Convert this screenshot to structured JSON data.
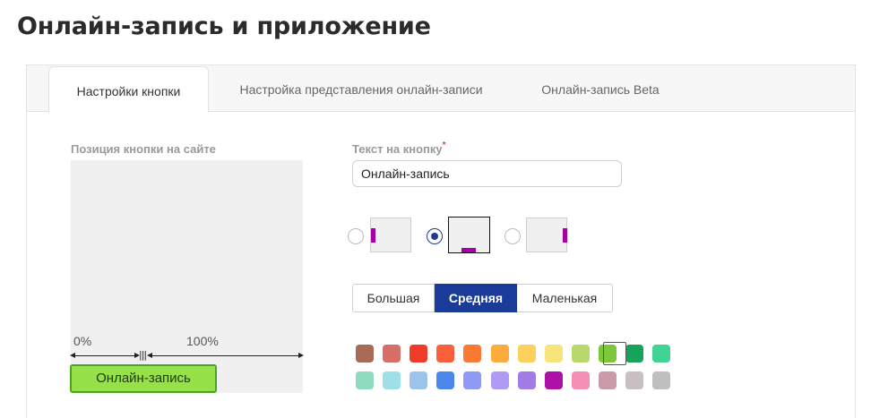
{
  "page": {
    "title": "Онлайн-запись и приложение"
  },
  "tabs": [
    {
      "label": "Настройки кнопки",
      "active": true
    },
    {
      "label": "Настройка представления онлайн-записи",
      "active": false
    },
    {
      "label": "Онлайн-запись Beta",
      "active": false
    }
  ],
  "position": {
    "label": "Позиция кнопки на сайте",
    "left_percent": "0%",
    "right_percent": "100%",
    "preview_button_label": "Онлайн-запись"
  },
  "button_text": {
    "label": "Текст на кнопку",
    "required_mark": "*",
    "value": "Онлайн-запись"
  },
  "placement": {
    "options": [
      {
        "name": "left",
        "checked": false
      },
      {
        "name": "bottom",
        "checked": true
      },
      {
        "name": "right",
        "checked": false
      }
    ],
    "mark_color": "#a400a4"
  },
  "size": {
    "options": [
      {
        "label": "Большая",
        "active": false
      },
      {
        "label": "Средняя",
        "active": true
      },
      {
        "label": "Маленькая",
        "active": false
      }
    ]
  },
  "colors": {
    "selected_index": 9,
    "row1": [
      "#a76b57",
      "#d86e68",
      "#ef3b2a",
      "#f9603b",
      "#fb7a33",
      "#fdab3d",
      "#fdd15b",
      "#f7e57c",
      "#b9d76d",
      "#7ec73a",
      "#17a35a",
      "#3fd394"
    ],
    "row2": [
      "#8edcbd",
      "#9fdfe8",
      "#9ec3ec",
      "#4b87ec",
      "#8f9af5",
      "#b19af3",
      "#a27ce6",
      "#ac12a6",
      "#f58fb6",
      "#c99ba9",
      "#c9bfc3",
      "#bfbfbf"
    ]
  }
}
